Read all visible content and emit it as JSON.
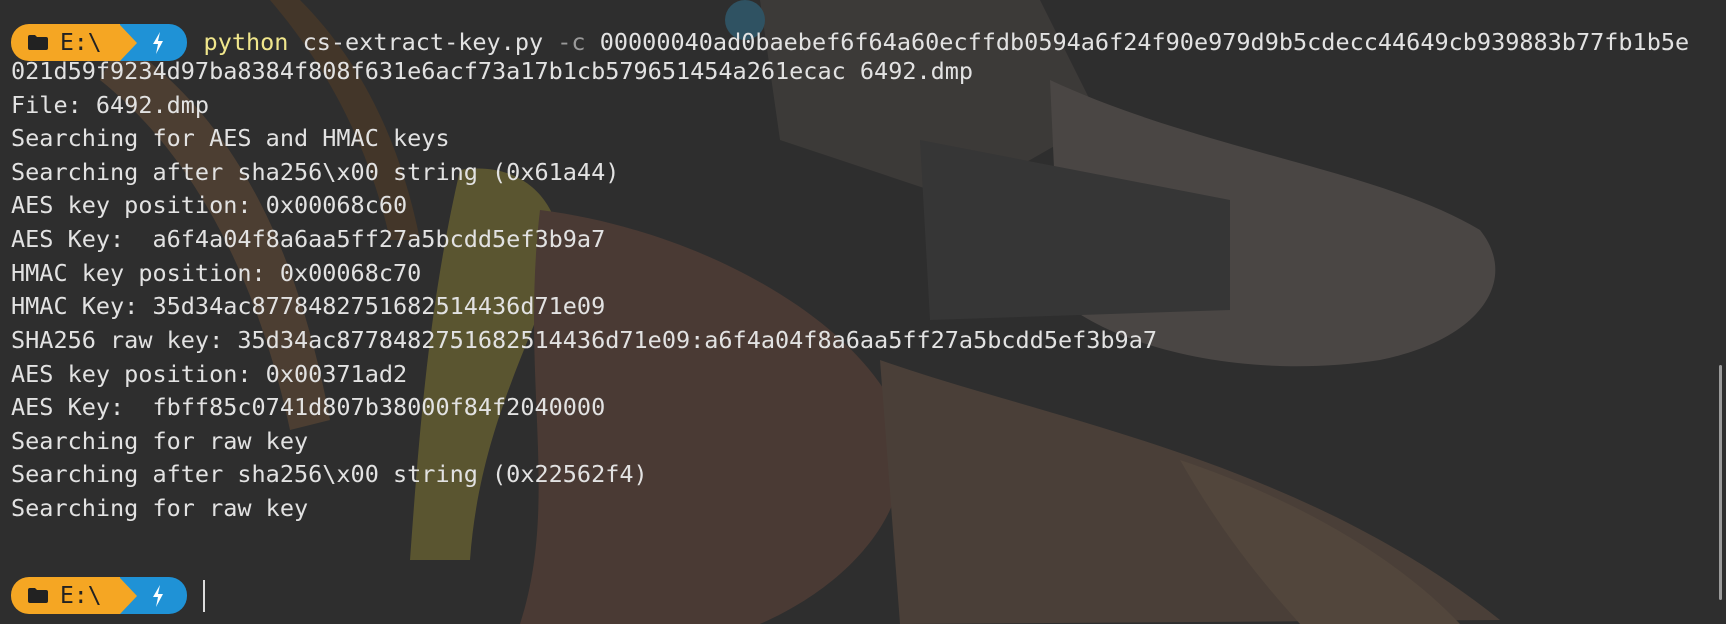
{
  "prompt": {
    "directory": "E:\\",
    "folder_icon": "folder-icon",
    "power_icon": "lightning-bolt-icon",
    "dir_color": "#f5a623",
    "power_color": "#1f92d6"
  },
  "command": {
    "program": "python",
    "script": "cs-extract-key.py",
    "flag": "-c",
    "arg_part1": "00000040ad0baebef6f64a60ecffdb0594a6f24f90e979d9b5cdecc44649cb939883b77fb1b5e",
    "arg_part2": "021d59f9234d97ba8384f808f631e6acf73a17b1cb579651454a261ecac 6492.dmp"
  },
  "output": [
    "File: 6492.dmp",
    "Searching for AES and HMAC keys",
    "Searching after sha256\\x00 string (0x61a44)",
    "AES key position: 0x00068c60",
    "AES Key:  a6f4a04f8a6aa5ff27a5bcdd5ef3b9a7",
    "HMAC key position: 0x00068c70",
    "HMAC Key: 35d34ac8778482751682514436d71e09",
    "SHA256 raw key: 35d34ac8778482751682514436d71e09:a6f4a04f8a6aa5ff27a5bcdd5ef3b9a7",
    "AES key position: 0x00371ad2",
    "AES Key:  fbff85c0741d807b38000f84f2040000",
    "Searching for raw key",
    "Searching after sha256\\x00 string (0x22562f4)",
    "Searching for raw key"
  ]
}
